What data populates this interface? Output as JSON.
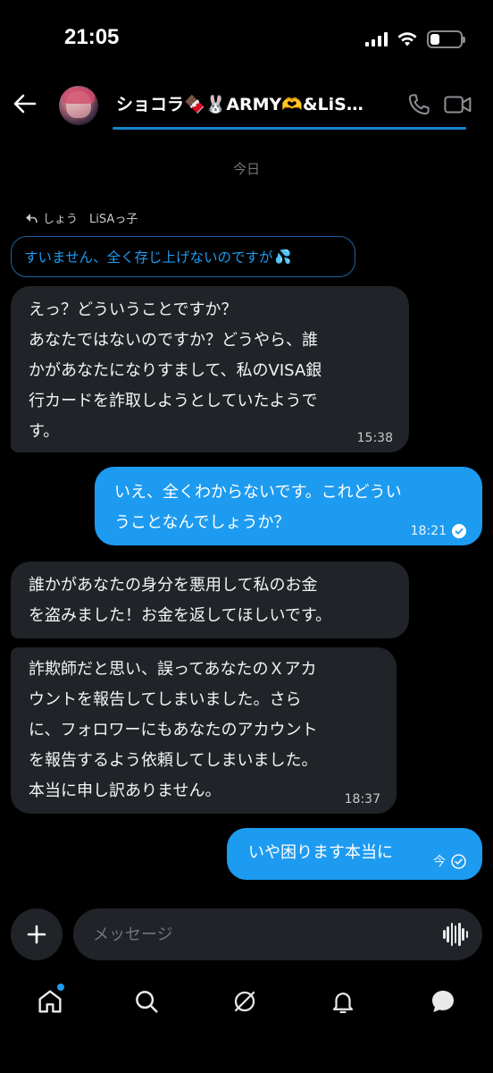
{
  "status_bar": {
    "time": "21:05",
    "icons": [
      "signal-icon",
      "wifi-icon",
      "battery-icon"
    ],
    "battery_level": 0.3
  },
  "header": {
    "title": "ショコラ🍫🐰ARMY🫶&LiS…",
    "icons": [
      "back-arrow-icon",
      "phone-icon",
      "video-icon"
    ],
    "accent_color": "#1d9bf0"
  },
  "conversation": {
    "date_separator": "今日",
    "reply_reference": "しょう　LiSAっ子",
    "quoted_message": "すいません、全く存じ上げないのですが",
    "quoted_emoji": "💦",
    "messages": [
      {
        "sender": "other",
        "text": "えっ？どういうことですか？\nあなたではないのですか？どうやら、誰\nかがあなたになりすまして、私のVISA銀\n行カードを詐取しようとしていたようで\nす。",
        "time": "15:38"
      },
      {
        "sender": "me",
        "text": "いえ、全くわからないです。これどうい\nうことなんでしょうか？",
        "time": "18:21",
        "status": "read"
      },
      {
        "sender": "other",
        "text": "誰かがあなたの身分を悪用して私のお金\nを盗みました！お金を返してほしいです。",
        "time": ""
      },
      {
        "sender": "other",
        "text": "詐欺師だと思い、誤ってあなたのＸアカ\nウントを報告してしまいました。さら\nに、フォロワーにもあなたのアカウント\nを報告するよう依頼してしまいました。\n本当に申し訳ありません。",
        "time": "18:37"
      },
      {
        "sender": "me",
        "text": "いや困ります本当に",
        "time": "今",
        "status": "sent"
      }
    ]
  },
  "composer": {
    "placeholder": "メッセージ",
    "icons": [
      "plus-icon",
      "voice-waveform-icon"
    ]
  },
  "bottom_nav": {
    "items": [
      "home-icon",
      "search-icon",
      "grok-icon",
      "notifications-icon",
      "messages-icon"
    ],
    "home_has_notification": true
  },
  "colors": {
    "background": "#000000",
    "bubble_other": "#202327",
    "bubble_me": "#1d9bf0",
    "muted_text": "#71767b"
  }
}
